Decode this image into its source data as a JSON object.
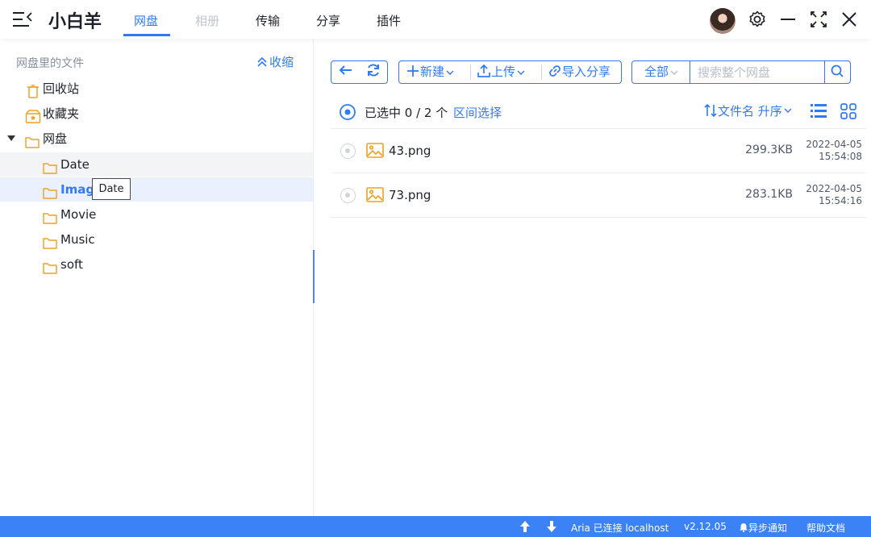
{
  "app": {
    "title": "小白羊"
  },
  "tabs": [
    {
      "label": "网盘",
      "state": "active"
    },
    {
      "label": "相册",
      "state": "disabled"
    },
    {
      "label": "传输",
      "state": "normal"
    },
    {
      "label": "分享",
      "state": "normal"
    },
    {
      "label": "插件",
      "state": "normal"
    }
  ],
  "sidebar": {
    "header": "网盘里的文件",
    "collapse_label": "收缩",
    "items": [
      {
        "label": "回收站",
        "icon": "trash-icon"
      },
      {
        "label": "收藏夹",
        "icon": "favorites-icon"
      },
      {
        "label": "网盘",
        "icon": "folder-icon",
        "expanded": true
      },
      {
        "label": "Date",
        "icon": "folder-icon"
      },
      {
        "label": "Image",
        "icon": "folder-icon",
        "selected": true
      },
      {
        "label": "Movie",
        "icon": "folder-icon"
      },
      {
        "label": "Music",
        "icon": "folder-icon"
      },
      {
        "label": "soft",
        "icon": "folder-icon"
      }
    ],
    "tooltip": "Date"
  },
  "toolbar": {
    "new_label": "新建",
    "upload_label": "上传",
    "import_share_label": "导入分享",
    "scope_label": "全部",
    "search_placeholder": "搜索整个网盘"
  },
  "selection": {
    "text": "已选中 0 / 2 个",
    "range_label": "区间选择",
    "sort_label": "文件名 升序"
  },
  "files": [
    {
      "name": "43.png",
      "size": "299.3KB",
      "date": "2022-04-05",
      "time": "15:54:08"
    },
    {
      "name": "73.png",
      "size": "283.1KB",
      "date": "2022-04-05",
      "time": "15:54:16"
    }
  ],
  "statusbar": {
    "aria_status": "Aria 已连接 localhost",
    "version": "v2.12.05",
    "notify_label": "异步通知",
    "help_label": "帮助文档"
  },
  "colors": {
    "accent": "#2f7bf6",
    "statusbar": "#3b82f6",
    "folder": "#f0a020",
    "selected_row": "#eaf0fe"
  }
}
